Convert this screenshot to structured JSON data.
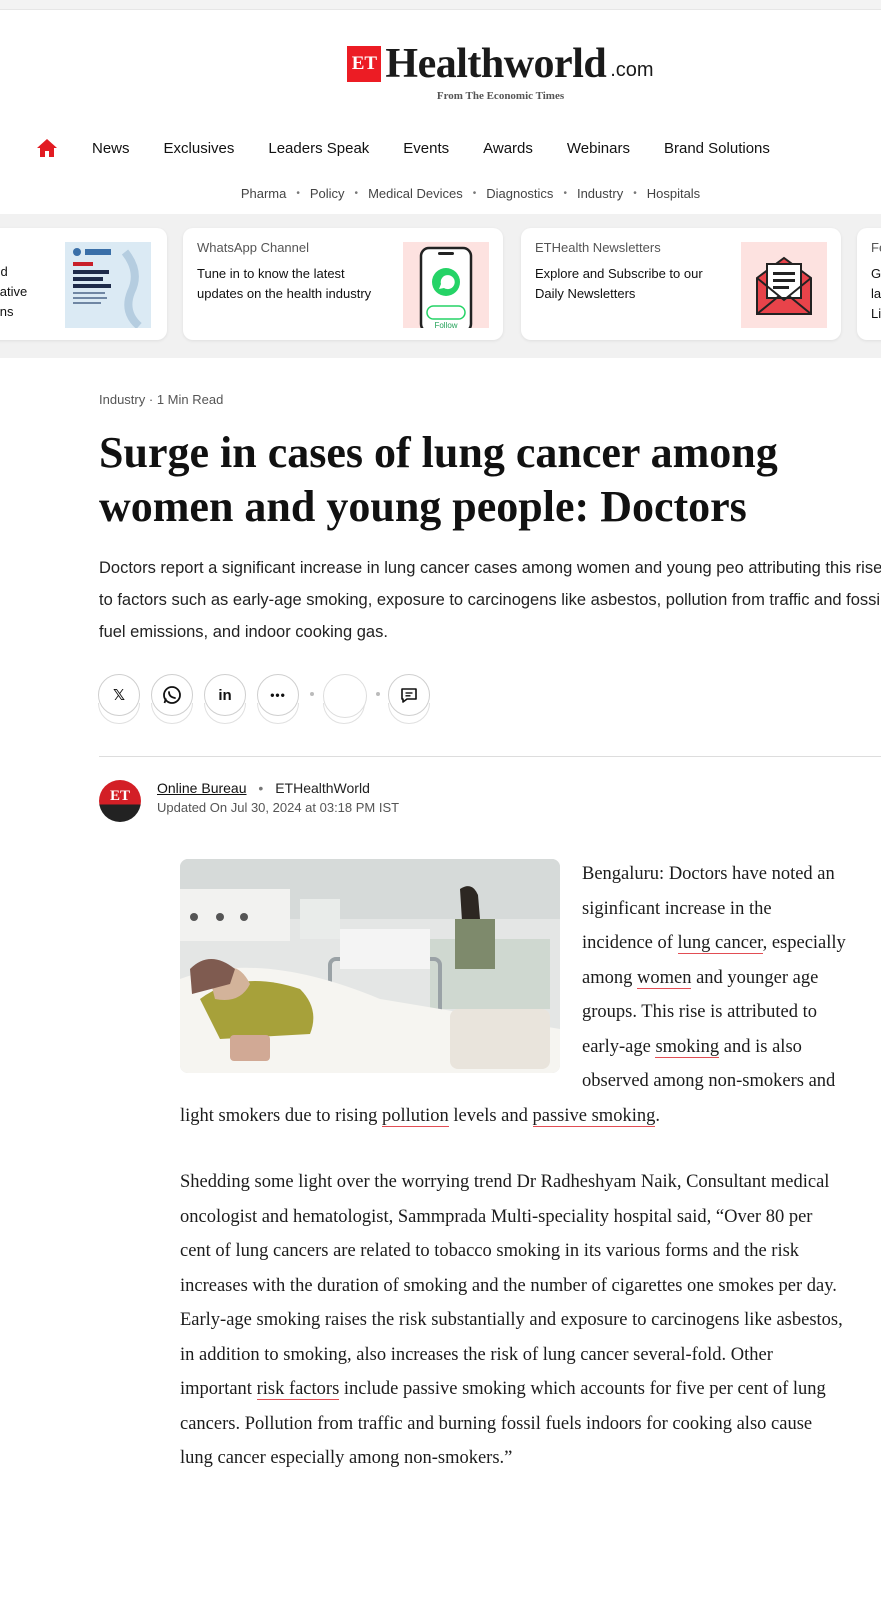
{
  "brand": {
    "logo_mark": "ET",
    "logo_name": "Healthworld",
    "logo_suffix": ".com",
    "tagline": "From The Economic Times",
    "accent_color": "#ec1c24"
  },
  "main_nav": {
    "home_icon": "home-icon",
    "items": [
      "News",
      "Exclusives",
      "Leaders Speak",
      "Events",
      "Awards",
      "Webinars",
      "Brand Solutions"
    ]
  },
  "sub_nav": {
    "items": [
      "Pharma",
      "Policy",
      "Medical Devices",
      "Diagnostics",
      "Industry",
      "Hospitals"
    ],
    "separator": "•"
  },
  "promos": [
    {
      "kicker": "",
      "text": "and\novative\ntions",
      "art_title": "Empowering Global Healthcare"
    },
    {
      "kicker": "WhatsApp Channel",
      "text": "Tune in to know the latest updates on the health industry",
      "art_label": "Follow"
    },
    {
      "kicker": "ETHealth Newsletters",
      "text": "Explore and Subscribe to our Daily Newsletters"
    },
    {
      "kicker": "Fe",
      "text": "G\nla\nLi"
    }
  ],
  "article": {
    "category": "Industry",
    "read_time": "1 Min Read",
    "headline_line1": "Surge in cases of lung cancer among",
    "headline_line2": "women and young people: Doctors",
    "dek": "Doctors report a significant increase in lung cancer cases among women and young peo attributing this rise to factors such as early-age smoking, exposure to carcinogens like asbestos, pollution from traffic and fossil fuel emissions, and indoor cooking gas.",
    "share": {
      "x_label": "𝕏",
      "linkedin_label": "in",
      "more_label": "•••"
    },
    "author": {
      "avatar_text": "ET",
      "name": "Online Bureau",
      "publication": "ETHealthWorld",
      "updated": "Updated On Jul 30, 2024 at 03:18 PM IST"
    },
    "paragraph1": {
      "t1": "Bengaluru: Doctors have noted an siginficant increase in the incidence of ",
      "l1": "lung cancer",
      "t2": ", especially among ",
      "l2": "women",
      "t3": " and younger age groups. This rise is attributed to early-age ",
      "l3": "smoking",
      "t4": " and is also observed among non-smokers and light smokers due to rising ",
      "l4": "pollution",
      "t5": " levels and ",
      "l5": "passive smoking",
      "t6": "."
    },
    "paragraph2": {
      "t1": "Shedding some light over the worrying trend Dr Radheshyam Naik, Consultant medical oncologist and hematologist, Sammprada Multi-speciality hospital said, “Over 80 per cent of lung cancers are related to tobacco smoking in its various forms and the risk increases with the duration of smoking and the number of cigarettes one smokes per day. Early-age smoking raises the risk substantially and exposure to carcinogens like asbestos, in addition to smoking, also increases the risk of lung cancer several-fold. Other important ",
      "l1": "risk factors",
      "t2": " include passive smoking which accounts for five per cent of lung cancers. Pollution from traffic and burning fossil fuels indoors for cooking also cause lung cancer especially among non-smokers.”"
    }
  }
}
